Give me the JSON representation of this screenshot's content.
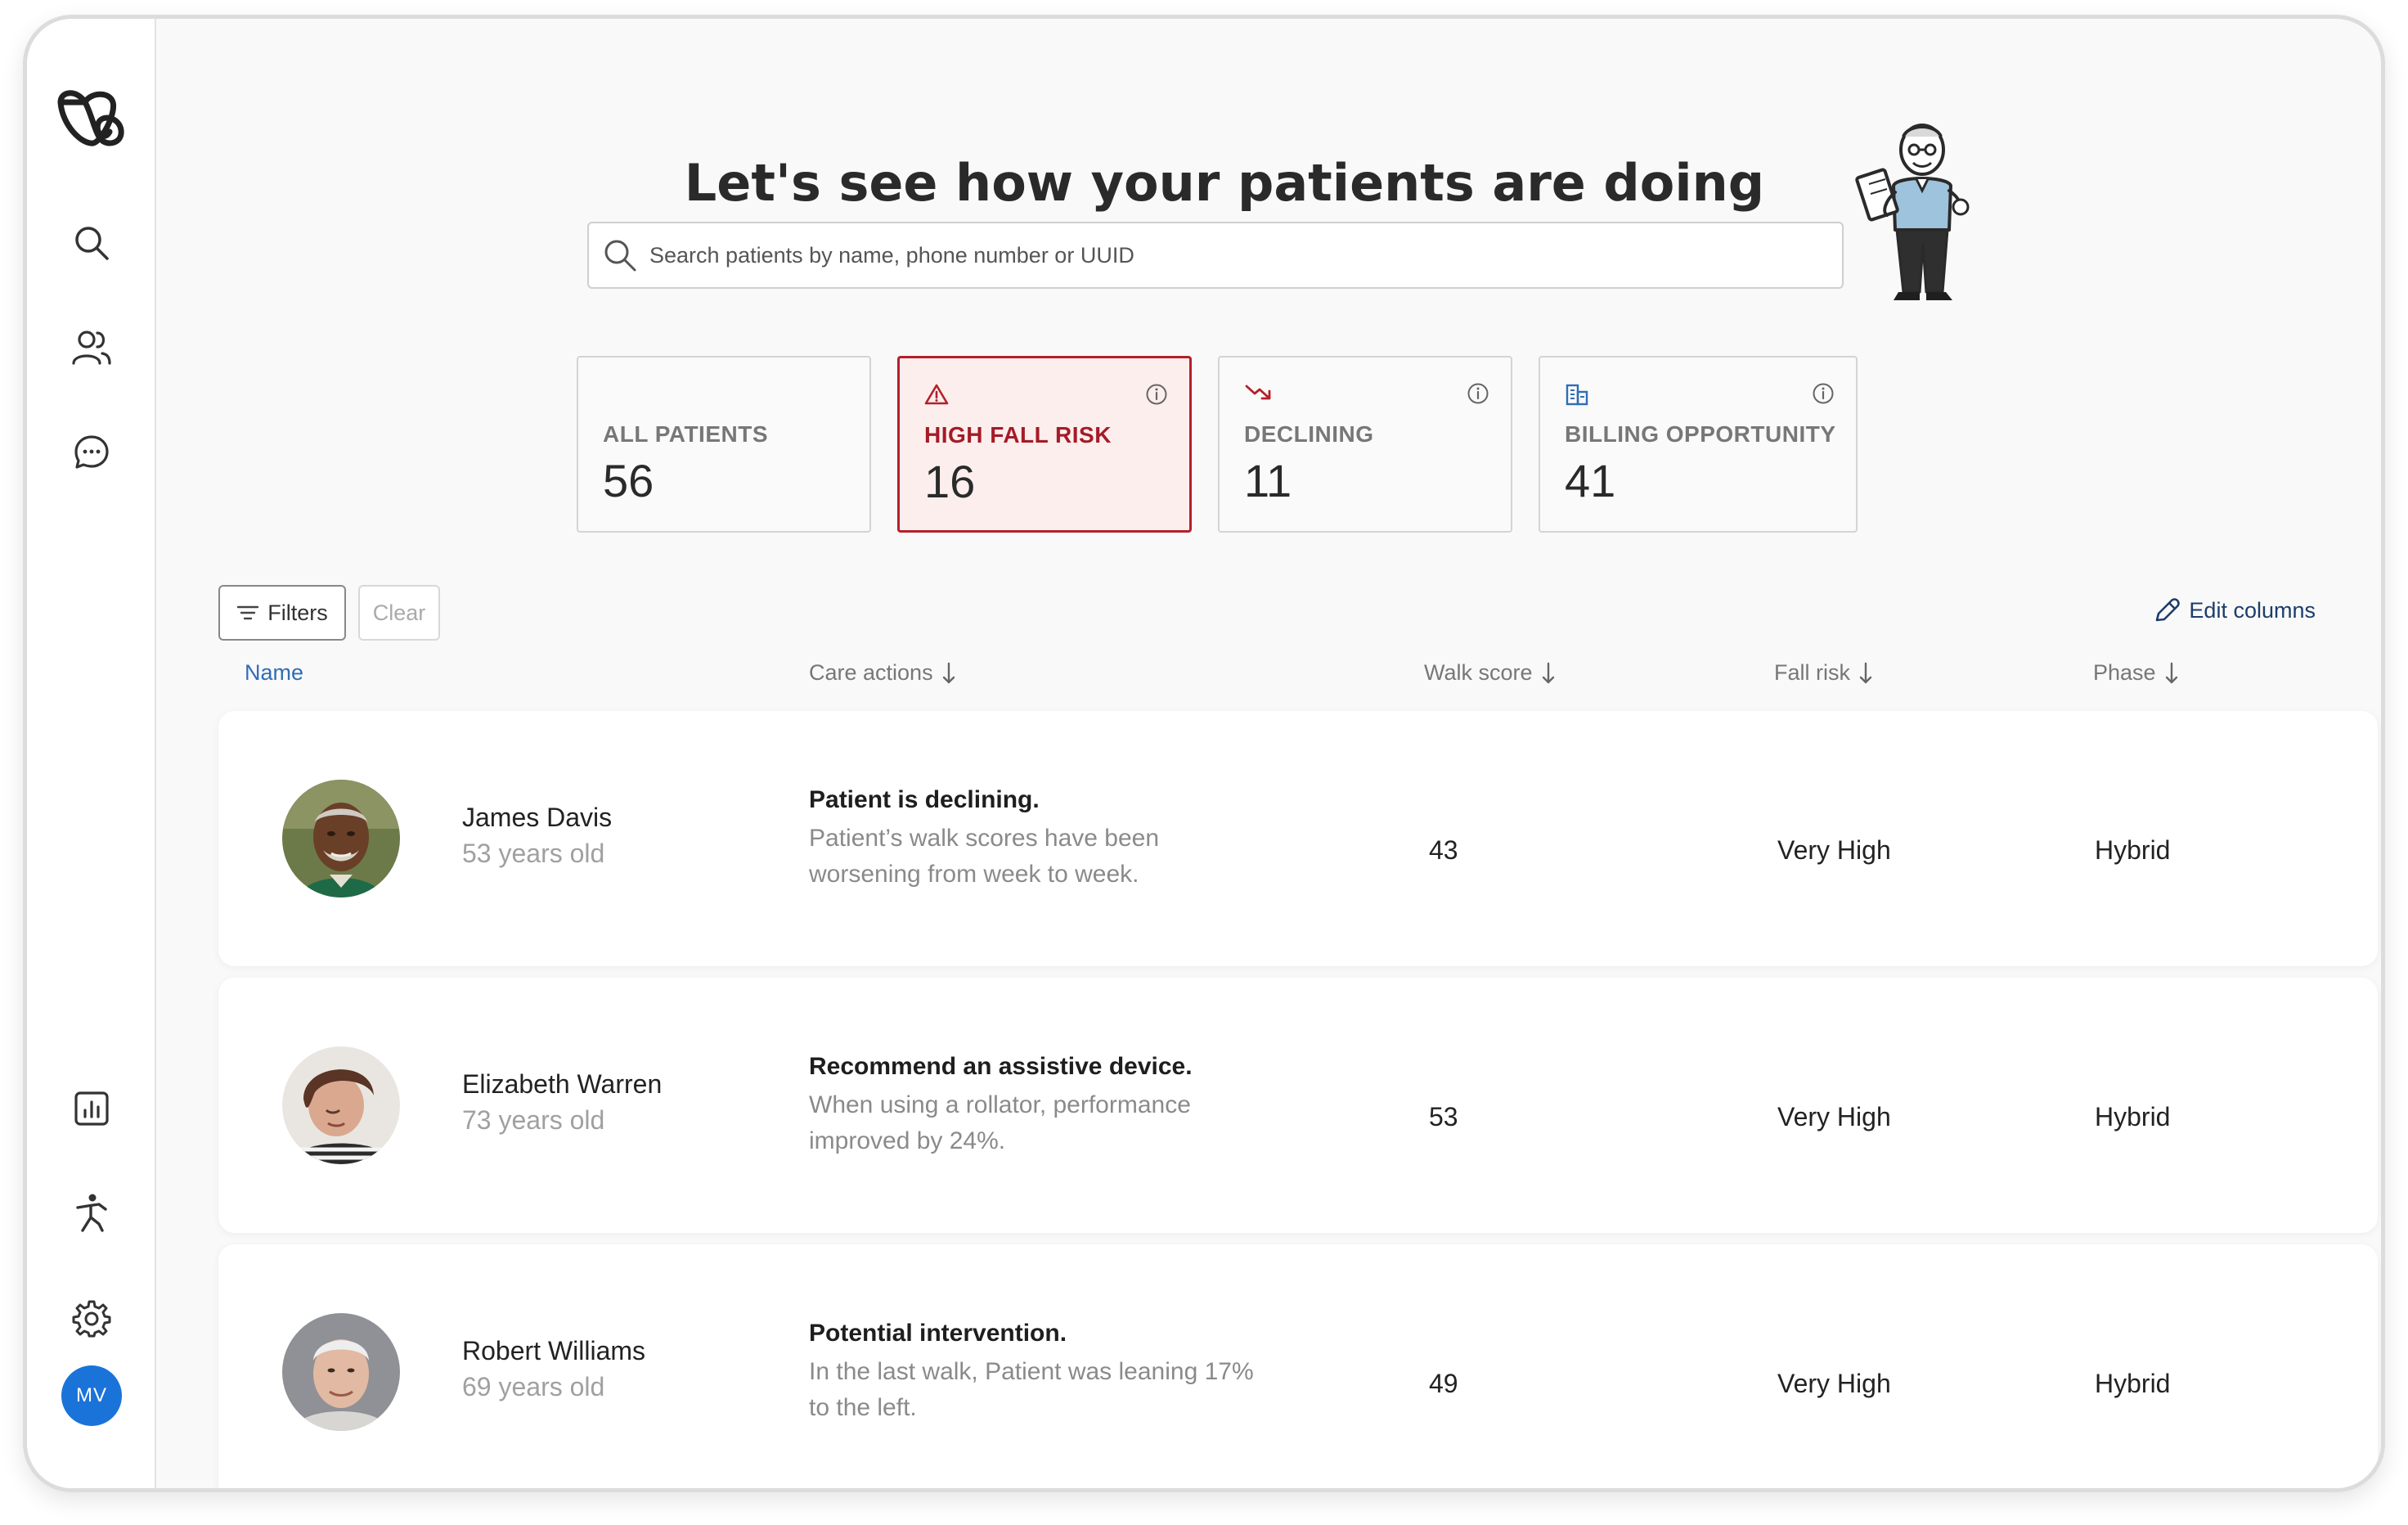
{
  "sidebar": {
    "logo": "logo-mark",
    "items": [
      {
        "icon": "search-icon"
      },
      {
        "icon": "users-icon"
      },
      {
        "icon": "chat-icon"
      },
      {
        "icon": "chart-icon"
      },
      {
        "icon": "walking-person-icon"
      },
      {
        "icon": "gear-icon"
      }
    ],
    "user_initials": "MV",
    "user_color": "#1a73d9"
  },
  "header": {
    "title": "Let's see how your patients are doing"
  },
  "search": {
    "placeholder": "Search patients by name, phone number or UUID"
  },
  "stats": [
    {
      "label": "ALL PATIENTS",
      "value": "56",
      "active": false
    },
    {
      "label": "HIGH FALL RISK",
      "value": "16",
      "active": true,
      "icon": "warning-icon"
    },
    {
      "label": "DECLINING",
      "value": "11",
      "active": false,
      "icon": "trend-down-icon"
    },
    {
      "label": "BILLING OPPORTUNITY",
      "value": "41",
      "active": false,
      "icon": "building-icon"
    }
  ],
  "toolbar": {
    "filters_label": "Filters",
    "clear_label": "Clear",
    "edit_columns_label": "Edit columns"
  },
  "table": {
    "columns": [
      "Name",
      "Care actions",
      "Walk score",
      "Fall risk",
      "Phase"
    ],
    "rows": [
      {
        "name": "James Davis",
        "age": "53 years old",
        "action_title": "Patient is declining.",
        "action_desc": "Patient’s walk scores have been worsening from week to week.",
        "walk_score": "43",
        "fall_risk": "Very High",
        "phase": "Hybrid"
      },
      {
        "name": "Elizabeth Warren",
        "age": "73 years old",
        "action_title": "Recommend an assistive device.",
        "action_desc": "When using a rollator, performance improved by 24%.",
        "walk_score": "53",
        "fall_risk": "Very High",
        "phase": "Hybrid"
      },
      {
        "name": "Robert Williams",
        "age": "69 years old",
        "action_title": "Potential intervention.",
        "action_desc": "In the last walk, Patient was leaning 17% to the left.",
        "walk_score": "49",
        "fall_risk": "Very High",
        "phase": "Hybrid"
      }
    ]
  },
  "colors": {
    "accent_red": "#b3202a",
    "link_blue": "#2f6db5",
    "active_card_bg": "#fdeeee"
  }
}
